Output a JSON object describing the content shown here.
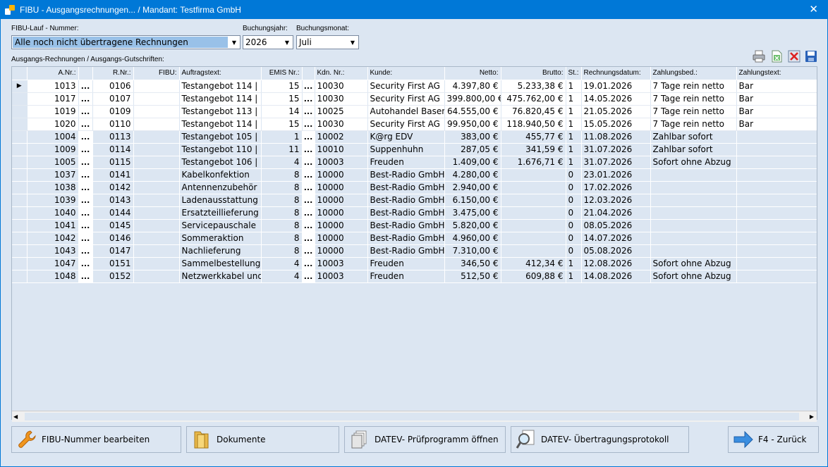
{
  "window": {
    "title": "FIBU - Ausgangsrechnungen... / Mandant: Testfirma GmbH",
    "close_glyph": "✕"
  },
  "form": {
    "fibu_lauf_label": "FIBU-Lauf - Nummer:",
    "fibu_lauf_value": "Alle noch nicht übertragene Rechnungen",
    "jahr_label": "Buchungsjahr:",
    "jahr_value": "2026",
    "monat_label": "Buchungsmonat:",
    "monat_value": "Juli",
    "list_label": "Ausgangs-Rechnungen / Ausgangs-Gutschriften:"
  },
  "toolbar_icons": [
    "printer-icon",
    "excel-export-icon",
    "delete-icon",
    "save-icon"
  ],
  "grid": {
    "columns": [
      "",
      "A.Nr.:",
      "",
      "R.Nr.:",
      "FIBU:",
      "Auftragstext:",
      "EMIS Nr.:",
      "",
      "Kdn. Nr.:",
      "Kunde:",
      "Netto:",
      "Brutto:",
      "St.:",
      "Rechnungsdatum:",
      "Zahlungsbed.:",
      "Zahlungstext:"
    ],
    "dots": "...",
    "current_row_marker": "▶",
    "rows": [
      {
        "anr": "1013",
        "rnr": "0106",
        "fibu": "",
        "auftrag": "Testangebot 114 |",
        "emis": "15",
        "kdn": "10030",
        "kunde": "Security First AG",
        "netto": "4.397,80 €",
        "brutto": "5.233,38 €",
        "st": "1",
        "datum": "19.01.2026",
        "bed": "7 Tage rein netto",
        "text": "Bar",
        "white": true
      },
      {
        "anr": "1017",
        "rnr": "0107",
        "fibu": "",
        "auftrag": "Testangebot 114 |",
        "emis": "15",
        "kdn": "10030",
        "kunde": "Security First AG",
        "netto": "399.800,00 €",
        "brutto": "475.762,00 €",
        "st": "1",
        "datum": "14.05.2026",
        "bed": "7 Tage rein netto",
        "text": "Bar",
        "white": true
      },
      {
        "anr": "1019",
        "rnr": "0109",
        "fibu": "",
        "auftrag": "Testangebot 113 |",
        "emis": "14",
        "kdn": "10025",
        "kunde": "Autohandel Basen",
        "netto": "64.555,00 €",
        "brutto": "76.820,45 €",
        "st": "1",
        "datum": "21.05.2026",
        "bed": "7 Tage rein netto",
        "text": "Bar",
        "white": true
      },
      {
        "anr": "1020",
        "rnr": "0110",
        "fibu": "",
        "auftrag": "Testangebot 114 |",
        "emis": "15",
        "kdn": "10030",
        "kunde": "Security First AG",
        "netto": "99.950,00 €",
        "brutto": "118.940,50 €",
        "st": "1",
        "datum": "15.05.2026",
        "bed": "7 Tage rein netto",
        "text": "Bar",
        "white": true
      },
      {
        "anr": "1004",
        "rnr": "0113",
        "fibu": "",
        "auftrag": "Testangebot 105 |",
        "emis": "1",
        "kdn": "10002",
        "kunde": "K@rg EDV",
        "netto": "383,00 €",
        "brutto": "455,77 €",
        "st": "1",
        "datum": "11.08.2026",
        "bed": "Zahlbar sofort",
        "text": "",
        "white": false
      },
      {
        "anr": "1009",
        "rnr": "0114",
        "fibu": "",
        "auftrag": "Testangebot 110 |",
        "emis": "11",
        "kdn": "10010",
        "kunde": "Suppenhuhn",
        "netto": "287,05 €",
        "brutto": "341,59 €",
        "st": "1",
        "datum": "31.07.2026",
        "bed": "Zahlbar sofort",
        "text": "",
        "white": false
      },
      {
        "anr": "1005",
        "rnr": "0115",
        "fibu": "",
        "auftrag": "Testangebot 106 |",
        "emis": "4",
        "kdn": "10003",
        "kunde": "Freuden",
        "netto": "1.409,00 €",
        "brutto": "1.676,71 €",
        "st": "1",
        "datum": "31.07.2026",
        "bed": "Sofort ohne Abzug",
        "text": "",
        "white": false
      },
      {
        "anr": "1037",
        "rnr": "0141",
        "fibu": "",
        "auftrag": "Kabelkonfektion",
        "emis": "8",
        "kdn": "10000",
        "kunde": "Best-Radio GmbH",
        "netto": "4.280,00 €",
        "brutto": "",
        "st": "0",
        "datum": "23.01.2026",
        "bed": "",
        "text": "",
        "white": false
      },
      {
        "anr": "1038",
        "rnr": "0142",
        "fibu": "",
        "auftrag": "Antennenzubehör",
        "emis": "8",
        "kdn": "10000",
        "kunde": "Best-Radio GmbH",
        "netto": "2.940,00 €",
        "brutto": "",
        "st": "0",
        "datum": "17.02.2026",
        "bed": "",
        "text": "",
        "white": false
      },
      {
        "anr": "1039",
        "rnr": "0143",
        "fibu": "",
        "auftrag": "Ladenausstattung",
        "emis": "8",
        "kdn": "10000",
        "kunde": "Best-Radio GmbH",
        "netto": "6.150,00 €",
        "brutto": "",
        "st": "0",
        "datum": "12.03.2026",
        "bed": "",
        "text": "",
        "white": false
      },
      {
        "anr": "1040",
        "rnr": "0144",
        "fibu": "",
        "auftrag": "Ersatzteillieferung",
        "emis": "8",
        "kdn": "10000",
        "kunde": "Best-Radio GmbH",
        "netto": "3.475,00 €",
        "brutto": "",
        "st": "0",
        "datum": "21.04.2026",
        "bed": "",
        "text": "",
        "white": false
      },
      {
        "anr": "1041",
        "rnr": "0145",
        "fibu": "",
        "auftrag": "Servicepauschale",
        "emis": "8",
        "kdn": "10000",
        "kunde": "Best-Radio GmbH",
        "netto": "5.820,00 €",
        "brutto": "",
        "st": "0",
        "datum": "08.05.2026",
        "bed": "",
        "text": "",
        "white": false
      },
      {
        "anr": "1042",
        "rnr": "0146",
        "fibu": "",
        "auftrag": "Sommeraktion",
        "emis": "8",
        "kdn": "10000",
        "kunde": "Best-Radio GmbH",
        "netto": "4.960,00 €",
        "brutto": "",
        "st": "0",
        "datum": "14.07.2026",
        "bed": "",
        "text": "",
        "white": false
      },
      {
        "anr": "1043",
        "rnr": "0147",
        "fibu": "",
        "auftrag": "Nachlieferung",
        "emis": "8",
        "kdn": "10000",
        "kunde": "Best-Radio GmbH",
        "netto": "7.310,00 €",
        "brutto": "",
        "st": "0",
        "datum": "05.08.2026",
        "bed": "",
        "text": "",
        "white": false
      },
      {
        "anr": "1047",
        "rnr": "0151",
        "fibu": "",
        "auftrag": "Sammelbestellung",
        "emis": "4",
        "kdn": "10003",
        "kunde": "Freuden",
        "netto": "346,50 €",
        "brutto": "412,34 €",
        "st": "1",
        "datum": "12.08.2026",
        "bed": "Sofort ohne Abzug",
        "text": "",
        "white": false
      },
      {
        "anr": "1048",
        "rnr": "0152",
        "fibu": "",
        "auftrag": "Netzwerkkabel und",
        "emis": "4",
        "kdn": "10003",
        "kunde": "Freuden",
        "netto": "512,50 €",
        "brutto": "609,88 €",
        "st": "1",
        "datum": "14.08.2026",
        "bed": "Sofort ohne Abzug",
        "text": "",
        "white": false
      }
    ]
  },
  "buttons": {
    "edit_fibu": "FIBU-Nummer bearbeiten",
    "documents": "Dokumente",
    "datev_check": "DATEV- Prüfprogramm öffnen",
    "datev_protocol": "DATEV- Übertragungsprotokoll",
    "back": "F4 - Zurück"
  }
}
